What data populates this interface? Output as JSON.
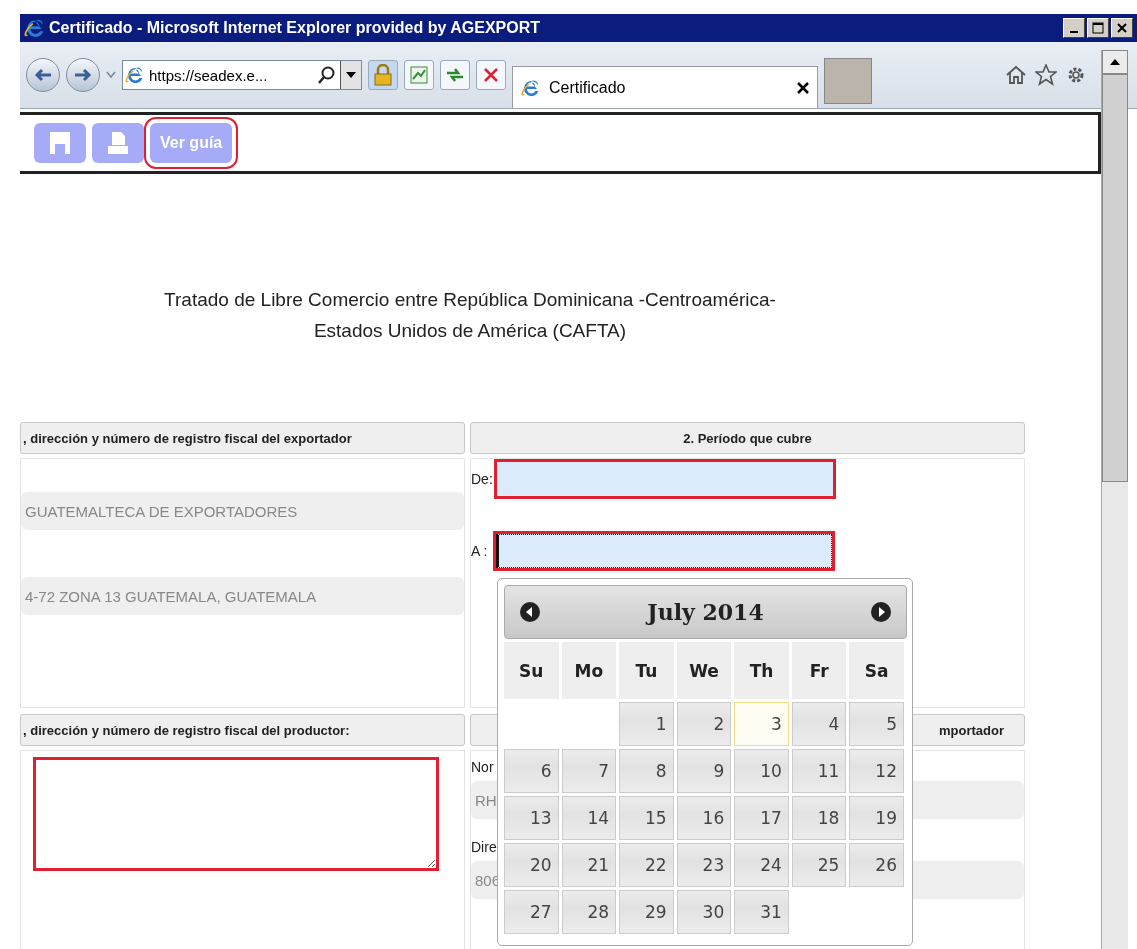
{
  "window": {
    "title": "Certificado - Microsoft Internet Explorer provided by AGEXPORT"
  },
  "address_bar": {
    "value": "https://seadex.e..."
  },
  "tabs": [
    {
      "label": "Certificado",
      "selected": true
    }
  ],
  "toolbar": {
    "buttons": [
      {
        "kind": "save",
        "highlighted": false
      },
      {
        "kind": "print",
        "highlighted": false
      },
      {
        "kind": "text",
        "label": "Ver guía",
        "highlighted": true
      }
    ]
  },
  "document": {
    "title_lines": [
      "Tratado de Libre Comercio entre República Dominicana -Centroamérica-",
      "Estados Unidos de América (CAFTA)"
    ]
  },
  "exporter": {
    "header": ", dirección y número de registro fiscal del exportador",
    "values": [
      "GUATEMALTECA DE EXPORTADORES",
      "4-72 ZONA 13 GUATEMALA, GUATEMALA"
    ]
  },
  "period": {
    "header": "2. Período que cubre",
    "fields": [
      {
        "label": "De:",
        "highlighted": true,
        "focused": false
      },
      {
        "label": "A :",
        "highlighted": true,
        "focused": true
      }
    ]
  },
  "producer": {
    "header": ", dirección y número de registro fiscal del productor:",
    "box": {
      "highlighted": true
    }
  },
  "importer": {
    "header": "mportador",
    "fields": [
      {
        "label": "Nor",
        "value": "RH"
      },
      {
        "label": "Dire",
        "value": "806"
      }
    ]
  },
  "calendar": {
    "month": "July 2014",
    "day_names": [
      "Su",
      "Mo",
      "Tu",
      "We",
      "Th",
      "Fr",
      "Sa"
    ],
    "weeks": [
      [
        {
          "kind": "blank"
        },
        {
          "kind": "blank"
        },
        {
          "label": "1",
          "today": false
        },
        {
          "label": "2",
          "today": false
        },
        {
          "label": "3",
          "today": true
        },
        {
          "label": "4",
          "today": false
        },
        {
          "label": "5",
          "today": false
        }
      ],
      [
        {
          "label": "6",
          "today": false
        },
        {
          "label": "7",
          "today": false
        },
        {
          "label": "8",
          "today": false
        },
        {
          "label": "9",
          "today": false
        },
        {
          "label": "10",
          "today": false
        },
        {
          "label": "11",
          "today": false
        },
        {
          "label": "12",
          "today": false
        }
      ],
      [
        {
          "label": "13",
          "today": false
        },
        {
          "label": "14",
          "today": false
        },
        {
          "label": "15",
          "today": false
        },
        {
          "label": "16",
          "today": false
        },
        {
          "label": "17",
          "today": false
        },
        {
          "label": "18",
          "today": false
        },
        {
          "label": "19",
          "today": false
        }
      ],
      [
        {
          "label": "20",
          "today": false
        },
        {
          "label": "21",
          "today": false
        },
        {
          "label": "22",
          "today": false
        },
        {
          "label": "23",
          "today": false
        },
        {
          "label": "24",
          "today": false
        },
        {
          "label": "25",
          "today": false
        },
        {
          "label": "26",
          "today": false
        }
      ],
      [
        {
          "label": "27",
          "today": false
        },
        {
          "label": "28",
          "today": false
        },
        {
          "label": "29",
          "today": false
        },
        {
          "label": "30",
          "today": false
        },
        {
          "label": "31",
          "today": false
        },
        {
          "kind": "blank"
        },
        {
          "kind": "blank"
        }
      ]
    ]
  }
}
